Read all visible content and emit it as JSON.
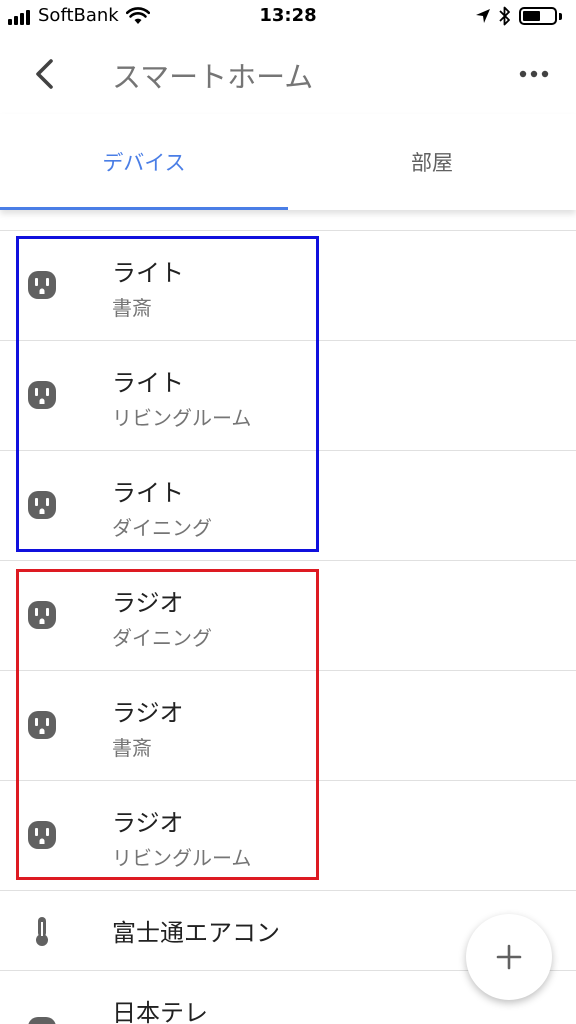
{
  "status_bar": {
    "carrier": "SoftBank",
    "time": "13:28",
    "battery_level": 0.55
  },
  "app_bar": {
    "title": "スマートホーム",
    "back_icon": "chevron-left-icon",
    "menu_icon": "more-horiz-icon"
  },
  "tabs": [
    {
      "label": "デバイス",
      "active": true
    },
    {
      "label": "部屋",
      "active": false
    }
  ],
  "colors": {
    "accent": "#4a7ee6",
    "highlight_blue": "#1010dd",
    "highlight_red": "#dd1a22",
    "icon_gray": "#616161"
  },
  "devices": [
    {
      "name": "ライト",
      "room": "書斎",
      "icon": "outlet-icon"
    },
    {
      "name": "ライト",
      "room": "リビングルーム",
      "icon": "outlet-icon"
    },
    {
      "name": "ライト",
      "room": "ダイニング",
      "icon": "outlet-icon"
    },
    {
      "name": "ラジオ",
      "room": "ダイニング",
      "icon": "outlet-icon"
    },
    {
      "name": "ラジオ",
      "room": "書斎",
      "icon": "outlet-icon"
    },
    {
      "name": "ラジオ",
      "room": "リビングルーム",
      "icon": "outlet-icon"
    },
    {
      "name": "富士通エアコン",
      "room": "",
      "icon": "thermometer-icon"
    },
    {
      "name": "日本テレ",
      "room": "",
      "icon": "outlet-icon"
    }
  ],
  "fab": {
    "icon": "plus-icon"
  }
}
